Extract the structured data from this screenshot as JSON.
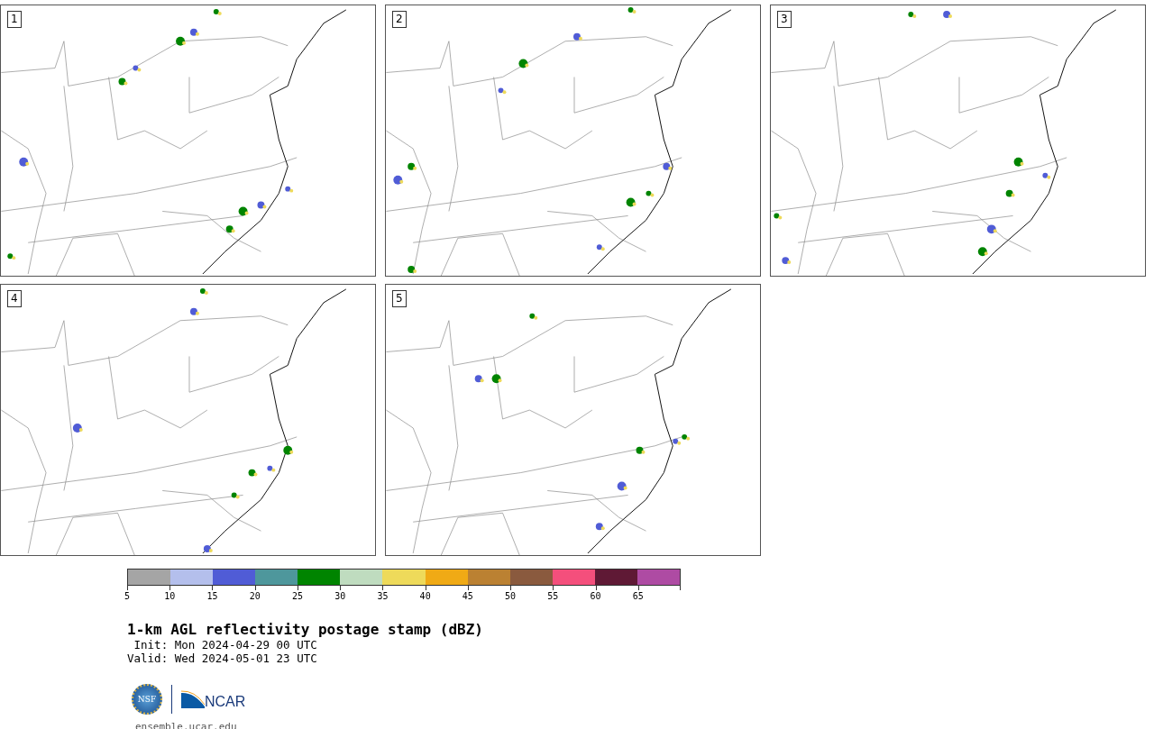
{
  "panels": [
    {
      "label": "1"
    },
    {
      "label": "2"
    },
    {
      "label": "3"
    },
    {
      "label": "4"
    },
    {
      "label": "5"
    }
  ],
  "colorbar": {
    "segments": [
      {
        "color": "#a5a5a5"
      },
      {
        "color": "#b4bfec"
      },
      {
        "color": "#505cd6"
      },
      {
        "color": "#4e979c"
      },
      {
        "color": "#008400"
      },
      {
        "color": "#bfdcbf"
      },
      {
        "color": "#eeda5a"
      },
      {
        "color": "#f0aa15"
      },
      {
        "color": "#bb8132"
      },
      {
        "color": "#8a5a3e"
      },
      {
        "color": "#f44f7c"
      },
      {
        "color": "#5f1935"
      },
      {
        "color": "#ae4ba3"
      }
    ],
    "ticks": [
      "5",
      "10",
      "15",
      "20",
      "25",
      "30",
      "35",
      "40",
      "45",
      "50",
      "55",
      "60",
      "65"
    ]
  },
  "title": "1-km AGL reflectivity postage stamp (dBZ)",
  "init": " Init: Mon 2024-04-29 00 UTC",
  "valid": "Valid: Wed 2024-05-01 23 UTC",
  "logo": {
    "left": "NSF",
    "right": "NCAR"
  },
  "url": "ensemble.ucar.edu"
}
